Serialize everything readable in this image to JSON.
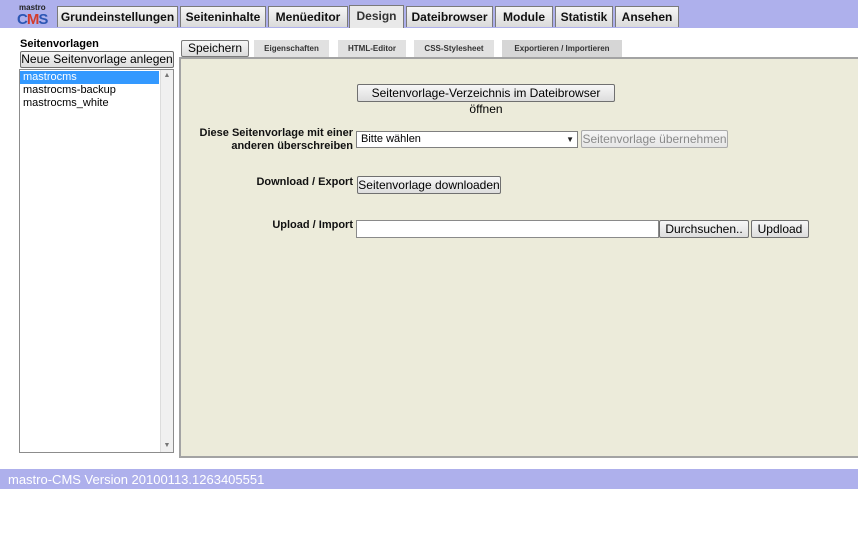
{
  "logo": {
    "small": "mastro",
    "c": "C",
    "m": "M",
    "s": "S"
  },
  "nav": {
    "tabs": [
      {
        "label": "Grundeinstellungen",
        "active": false
      },
      {
        "label": "Seiteninhalte",
        "active": false
      },
      {
        "label": "Menüeditor",
        "active": false
      },
      {
        "label": "Design",
        "active": true
      },
      {
        "label": "Dateibrowser",
        "active": false
      },
      {
        "label": "Module",
        "active": false
      },
      {
        "label": "Statistik",
        "active": false
      },
      {
        "label": "Ansehen",
        "active": false
      }
    ]
  },
  "sidebar": {
    "title": "Seitenvorlagen",
    "new_button": "Neue Seitenvorlage anlegen",
    "items": [
      {
        "label": "mastrocms",
        "selected": true
      },
      {
        "label": "mastrocms-backup",
        "selected": false
      },
      {
        "label": "mastrocms_white",
        "selected": false
      }
    ]
  },
  "subtabs": [
    {
      "label": "Speichern"
    },
    {
      "label": "Eigenschaften"
    },
    {
      "label": "HTML-Editor"
    },
    {
      "label": "CSS-Stylesheet"
    },
    {
      "label": "Exportieren / Importieren"
    }
  ],
  "export": {
    "open_dir_button": "Seitenvorlage-Verzeichnis im Dateibrowser öffnen",
    "overwrite_label_1": "Diese Seitenvorlage mit einer",
    "overwrite_label_2": "anderen überschreiben",
    "select_value": "Bitte wählen",
    "apply_button": "Seitenvorlage übernehmen",
    "download_label": "Download / Export",
    "download_button": "Seitenvorlage downloaden",
    "upload_label": "Upload / Import",
    "upload_value": "",
    "browse_button": "Durchsuchen..",
    "upload_button": "Updload"
  },
  "footer": {
    "text": "mastro-CMS Version 20100113.1263405551"
  },
  "colors": {
    "bar": "#aeb0ec",
    "panel": "#ecebda",
    "selection": "#3399ff"
  }
}
